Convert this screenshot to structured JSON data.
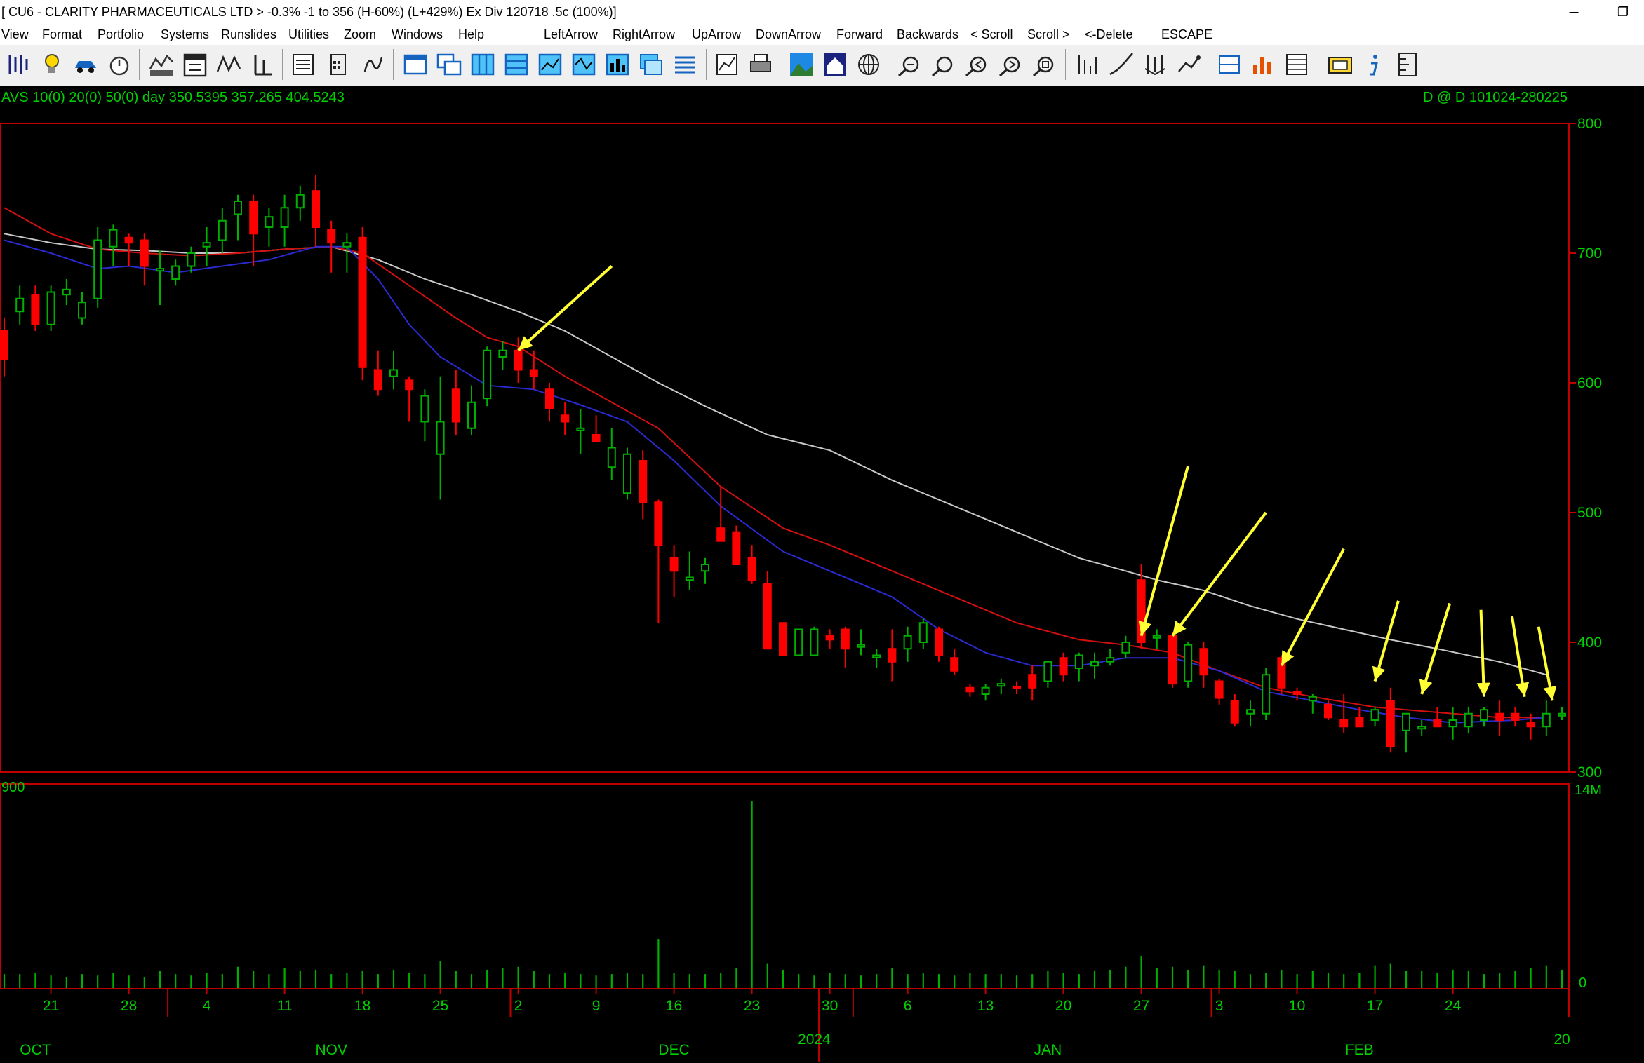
{
  "window": {
    "title": "[ CU6 - CLARITY PHARMACEUTICALS LTD > -0.3% -1 to 356 (H-60%) (L+429%)  Ex Div 120718  .5c  (100%)]",
    "minimize_glyph": "─",
    "restore_glyph": "❐"
  },
  "menu": [
    "View",
    "Format",
    "Portfolio",
    "Systems",
    "Runslides",
    "Utilities",
    "Zoom",
    "Windows",
    "Help",
    "LeftArrow",
    "RightArrow",
    "UpArrow",
    "DownArrow",
    "Forward",
    "Backwards",
    "< Scroll",
    "Scroll >",
    "<-Delete",
    "ESCAPE"
  ],
  "toolbar_icons": [
    "bars-icon",
    "lightbulb-icon",
    "car-icon",
    "stopwatch-icon",
    "indicator-1234-icon",
    "calendar-365-icon",
    "zigzag-icon",
    "point-figure-icon",
    "pfolio-icon",
    "calculator-icon",
    "formula-icon",
    "window-icon",
    "cascade-icon",
    "tile-vertical-icon",
    "tile-horizontal-icon",
    "chart-window-icon",
    "line-chart-icon",
    "bar-chart-icon",
    "layers-icon",
    "list-icon",
    "chart-book-icon",
    "print-icon",
    "landscape-icon",
    "house-icon",
    "web-icon",
    "zoom-in-icon",
    "zoom-out-icon",
    "zoom-left-icon",
    "zoom-right-icon",
    "zoom-fit-icon",
    "dwm-icon",
    "log-lin-icon",
    "candle-split-icon",
    "show-trade-icon",
    "data-f12-icon",
    "stack-chart-icon",
    "grid-icon",
    "export-icon",
    "info-icon",
    "ruler-icon"
  ],
  "colors": {
    "up_candle": "#00b000",
    "down_candle": "#ff0000",
    "ma10": "#2a2ad0",
    "ma20": "#d01010",
    "ma50": "#c8c8c8",
    "arrow": "#ffff33",
    "frame": "#c00000",
    "axis_text": "#00d000",
    "volume": "#00b000"
  },
  "header": {
    "left": "AVS 10(0) 20(0) 50(0)  day    350.5395  357.265  404.5243",
    "right": "D @ D    101024-280225"
  },
  "chart_data": {
    "type": "candlestick",
    "symbol": "CU6",
    "moving_averages": [
      10,
      20,
      50
    ],
    "ma_latest": [
      350.5395,
      357.265,
      404.5243
    ],
    "ylim": [
      300,
      800
    ],
    "y_ticks": [
      300,
      400,
      500,
      600,
      700,
      800
    ],
    "volume_axis": {
      "top_label": "14M",
      "bottom_label": "0",
      "left_label": "900"
    },
    "x_day_labels": [
      {
        "label": "21",
        "i": 3
      },
      {
        "label": "28",
        "i": 8
      },
      {
        "label": "4",
        "i": 13
      },
      {
        "label": "11",
        "i": 18
      },
      {
        "label": "18",
        "i": 23
      },
      {
        "label": "25",
        "i": 28
      },
      {
        "label": "2",
        "i": 33
      },
      {
        "label": "9",
        "i": 38
      },
      {
        "label": "16",
        "i": 43
      },
      {
        "label": "23",
        "i": 48
      },
      {
        "label": "30",
        "i": 53
      },
      {
        "label": "6",
        "i": 58
      },
      {
        "label": "13",
        "i": 63
      },
      {
        "label": "20",
        "i": 68
      },
      {
        "label": "27",
        "i": 73
      },
      {
        "label": "3",
        "i": 78
      },
      {
        "label": "10",
        "i": 83
      },
      {
        "label": "17",
        "i": 88
      },
      {
        "label": "24",
        "i": 93
      }
    ],
    "x_month_labels": [
      {
        "label": "OCT",
        "i": 2
      },
      {
        "label": "NOV",
        "i": 21
      },
      {
        "label": "DEC",
        "i": 43
      },
      {
        "label": "JAN",
        "i": 67
      },
      {
        "label": "FEB",
        "i": 87
      }
    ],
    "year_labels": [
      {
        "label": "2024",
        "i": 52
      },
      {
        "label": "20",
        "i": 100
      }
    ],
    "month_separators": [
      10.5,
      32.5,
      54.5,
      77.5
    ],
    "candles": [
      [
        640,
        650,
        605,
        618
      ],
      [
        655,
        675,
        645,
        665
      ],
      [
        668,
        675,
        640,
        645
      ],
      [
        645,
        675,
        640,
        670
      ],
      [
        668,
        680,
        660,
        672
      ],
      [
        650,
        670,
        645,
        662
      ],
      [
        665,
        720,
        658,
        710
      ],
      [
        705,
        722,
        690,
        718
      ],
      [
        712,
        715,
        690,
        708
      ],
      [
        710,
        715,
        675,
        690
      ],
      [
        688,
        702,
        660,
        688
      ],
      [
        680,
        695,
        675,
        690
      ],
      [
        690,
        705,
        685,
        700
      ],
      [
        705,
        720,
        690,
        708
      ],
      [
        710,
        735,
        700,
        725
      ],
      [
        730,
        745,
        710,
        740
      ],
      [
        740,
        745,
        690,
        715
      ],
      [
        720,
        735,
        705,
        728
      ],
      [
        720,
        745,
        705,
        735
      ],
      [
        735,
        752,
        725,
        745
      ],
      [
        748,
        760,
        705,
        720
      ],
      [
        718,
        725,
        685,
        708
      ],
      [
        705,
        715,
        685,
        708
      ],
      [
        712,
        720,
        602,
        612
      ],
      [
        610,
        625,
        590,
        595
      ],
      [
        605,
        625,
        595,
        610
      ],
      [
        602,
        605,
        570,
        595
      ],
      [
        570,
        595,
        555,
        590
      ],
      [
        545,
        605,
        510,
        570
      ],
      [
        595,
        610,
        560,
        570
      ],
      [
        565,
        598,
        560,
        585
      ],
      [
        588,
        628,
        582,
        625
      ],
      [
        620,
        632,
        610,
        625
      ],
      [
        625,
        635,
        600,
        610
      ],
      [
        610,
        625,
        595,
        605
      ],
      [
        595,
        600,
        570,
        580
      ],
      [
        575,
        585,
        560,
        570
      ],
      [
        565,
        580,
        545,
        565
      ],
      [
        560,
        575,
        555,
        555
      ],
      [
        535,
        565,
        525,
        550
      ],
      [
        515,
        550,
        510,
        545
      ],
      [
        540,
        548,
        495,
        508
      ],
      [
        508,
        510,
        415,
        475
      ],
      [
        465,
        475,
        435,
        455
      ],
      [
        448,
        470,
        440,
        450
      ],
      [
        455,
        465,
        445,
        460
      ],
      [
        488,
        520,
        480,
        478
      ],
      [
        485,
        490,
        460,
        460
      ],
      [
        465,
        475,
        445,
        448
      ],
      [
        445,
        455,
        410,
        395
      ],
      [
        415,
        415,
        390,
        390
      ],
      [
        390,
        410,
        390,
        410
      ],
      [
        390,
        412,
        390,
        410
      ],
      [
        405,
        410,
        395,
        402
      ],
      [
        410,
        412,
        380,
        395
      ],
      [
        398,
        410,
        390,
        398
      ],
      [
        390,
        395,
        380,
        390
      ],
      [
        395,
        410,
        370,
        385
      ],
      [
        395,
        412,
        385,
        405
      ],
      [
        400,
        418,
        395,
        415
      ],
      [
        410,
        412,
        385,
        390
      ],
      [
        388,
        395,
        375,
        378
      ],
      [
        365,
        368,
        358,
        362
      ],
      [
        360,
        368,
        355,
        365
      ],
      [
        368,
        372,
        360,
        368
      ],
      [
        366,
        370,
        360,
        365
      ],
      [
        375,
        382,
        355,
        365
      ],
      [
        370,
        385,
        365,
        385
      ],
      [
        388,
        392,
        370,
        375
      ],
      [
        380,
        392,
        370,
        390
      ],
      [
        382,
        392,
        372,
        385
      ],
      [
        385,
        395,
        382,
        388
      ],
      [
        392,
        405,
        388,
        400
      ],
      [
        448,
        460,
        395,
        400
      ],
      [
        405,
        410,
        395,
        405
      ],
      [
        405,
        408,
        365,
        368
      ],
      [
        370,
        400,
        365,
        398
      ],
      [
        395,
        400,
        365,
        375
      ],
      [
        370,
        372,
        352,
        357
      ],
      [
        355,
        360,
        335,
        338
      ],
      [
        345,
        355,
        335,
        348
      ],
      [
        345,
        380,
        340,
        375
      ],
      [
        388,
        390,
        360,
        365
      ],
      [
        362,
        365,
        355,
        360
      ],
      [
        355,
        360,
        345,
        358
      ],
      [
        352,
        355,
        340,
        342
      ],
      [
        340,
        360,
        330,
        335
      ],
      [
        342,
        350,
        335,
        335
      ],
      [
        340,
        350,
        335,
        348
      ],
      [
        355,
        365,
        315,
        320
      ],
      [
        332,
        345,
        315,
        345
      ],
      [
        335,
        340,
        328,
        335
      ],
      [
        340,
        350,
        335,
        335
      ],
      [
        335,
        350,
        325,
        340
      ],
      [
        335,
        350,
        330,
        345
      ],
      [
        340,
        350,
        335,
        348
      ],
      [
        345,
        355,
        328,
        340
      ],
      [
        345,
        350,
        335,
        340
      ],
      [
        338,
        345,
        325,
        335
      ],
      [
        335,
        355,
        328,
        345
      ],
      [
        345,
        350,
        340,
        345
      ]
    ],
    "volume_labels_note": "",
    "volumes": [
      1.0,
      1.0,
      1.1,
      0.9,
      0.8,
      1.0,
      0.9,
      1.1,
      0.9,
      0.8,
      1.2,
      1.0,
      0.9,
      1.1,
      1.0,
      1.5,
      1.2,
      1.0,
      1.4,
      1.2,
      1.3,
      1.0,
      1.1,
      1.2,
      1.0,
      1.3,
      1.1,
      1.0,
      1.9,
      1.2,
      1.0,
      1.3,
      1.4,
      1.5,
      1.2,
      1.0,
      1.1,
      1.0,
      0.9,
      1.0,
      1.1,
      1.0,
      3.4,
      1.1,
      1.0,
      1.0,
      1.1,
      1.4,
      12.8,
      1.7,
      1.3,
      1.0,
      0.9,
      1.1,
      1.0,
      0.9,
      1.0,
      1.4,
      1.0,
      1.1,
      1.0,
      0.9,
      1.1,
      1.0,
      1.0,
      0.9,
      1.0,
      1.2,
      1.1,
      1.0,
      1.2,
      1.3,
      1.5,
      2.2,
      1.4,
      1.5,
      1.3,
      1.6,
      1.3,
      1.2,
      1.0,
      1.1,
      1.3,
      1.0,
      1.2,
      1.1,
      1.0,
      1.1,
      1.6,
      1.7,
      1.2,
      1.2,
      1.1,
      1.3,
      1.2,
      1.0,
      1.1,
      1.2,
      1.4,
      1.6,
      1.3
    ],
    "ma10_values": [
      [
        0,
        710
      ],
      [
        3,
        700
      ],
      [
        6,
        688
      ],
      [
        8,
        690
      ],
      [
        11,
        685
      ],
      [
        14,
        690
      ],
      [
        17,
        695
      ],
      [
        20,
        705
      ],
      [
        22,
        705
      ],
      [
        24,
        680
      ],
      [
        26,
        645
      ],
      [
        28,
        620
      ],
      [
        31,
        598
      ],
      [
        34,
        595
      ],
      [
        37,
        583
      ],
      [
        40,
        570
      ],
      [
        43,
        540
      ],
      [
        46,
        505
      ],
      [
        50,
        470
      ],
      [
        53,
        455
      ],
      [
        57,
        435
      ],
      [
        60,
        410
      ],
      [
        63,
        392
      ],
      [
        66,
        382
      ],
      [
        69,
        382
      ],
      [
        72,
        388
      ],
      [
        75,
        388
      ],
      [
        78,
        378
      ],
      [
        81,
        362
      ],
      [
        84,
        355
      ],
      [
        87,
        348
      ],
      [
        90,
        342
      ],
      [
        93,
        338
      ],
      [
        97,
        340
      ],
      [
        99,
        342
      ]
    ],
    "ma20_values": [
      [
        0,
        735
      ],
      [
        3,
        715
      ],
      [
        6,
        703
      ],
      [
        9,
        700
      ],
      [
        12,
        698
      ],
      [
        15,
        700
      ],
      [
        18,
        703
      ],
      [
        21,
        705
      ],
      [
        23,
        700
      ],
      [
        26,
        675
      ],
      [
        29,
        650
      ],
      [
        31,
        635
      ],
      [
        33,
        628
      ],
      [
        36,
        605
      ],
      [
        39,
        585
      ],
      [
        42,
        565
      ],
      [
        46,
        520
      ],
      [
        50,
        488
      ],
      [
        53,
        475
      ],
      [
        57,
        455
      ],
      [
        61,
        435
      ],
      [
        65,
        415
      ],
      [
        69,
        402
      ],
      [
        72,
        398
      ],
      [
        75,
        392
      ],
      [
        78,
        378
      ],
      [
        81,
        365
      ],
      [
        84,
        358
      ],
      [
        88,
        350
      ],
      [
        92,
        346
      ],
      [
        96,
        342
      ],
      [
        99,
        342
      ]
    ],
    "ma50_values": [
      [
        0,
        715
      ],
      [
        3,
        708
      ],
      [
        6,
        703
      ],
      [
        9,
        702
      ],
      [
        12,
        700
      ],
      [
        15,
        700
      ],
      [
        18,
        703
      ],
      [
        21,
        705
      ],
      [
        24,
        695
      ],
      [
        27,
        680
      ],
      [
        30,
        668
      ],
      [
        33,
        655
      ],
      [
        36,
        640
      ],
      [
        39,
        620
      ],
      [
        42,
        600
      ],
      [
        45,
        582
      ],
      [
        49,
        560
      ],
      [
        53,
        548
      ],
      [
        57,
        525
      ],
      [
        61,
        505
      ],
      [
        65,
        485
      ],
      [
        69,
        465
      ],
      [
        72,
        455
      ],
      [
        74,
        448
      ],
      [
        77,
        440
      ],
      [
        80,
        428
      ],
      [
        83,
        418
      ],
      [
        86,
        410
      ],
      [
        89,
        402
      ],
      [
        92,
        395
      ],
      [
        96,
        385
      ],
      [
        99,
        375
      ]
    ],
    "annotations": [
      {
        "type": "arrow",
        "from": [
          39,
          690
        ],
        "to": [
          33,
          625
        ]
      },
      {
        "type": "arrow",
        "from": [
          76,
          536
        ],
        "to": [
          73,
          405
        ]
      },
      {
        "type": "arrow",
        "from": [
          81,
          500
        ],
        "to": [
          75,
          405
        ]
      },
      {
        "type": "arrow",
        "from": [
          86,
          472
        ],
        "to": [
          82,
          382
        ]
      },
      {
        "type": "arrow",
        "from": [
          89.5,
          432
        ],
        "to": [
          88,
          370
        ]
      },
      {
        "type": "arrow",
        "from": [
          92.8,
          430
        ],
        "to": [
          91,
          360
        ]
      },
      {
        "type": "arrow",
        "from": [
          94.8,
          425
        ],
        "to": [
          95,
          358
        ]
      },
      {
        "type": "arrow",
        "from": [
          96.8,
          420
        ],
        "to": [
          97.6,
          358
        ]
      },
      {
        "type": "arrow",
        "from": [
          98.5,
          412
        ],
        "to": [
          99.4,
          355
        ]
      }
    ]
  }
}
